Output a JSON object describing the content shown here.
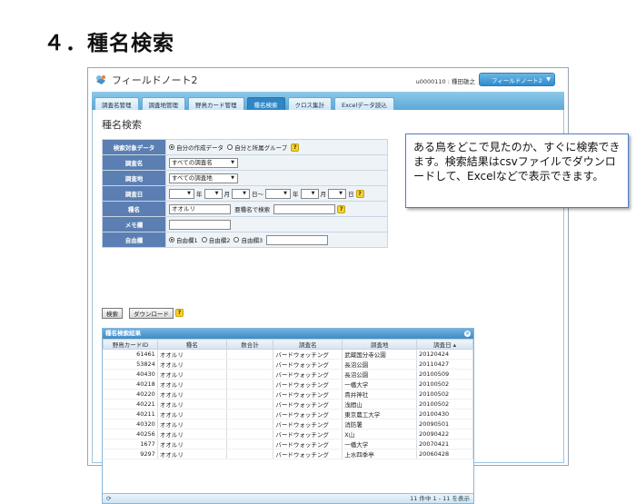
{
  "slide_title": "４．種名検索",
  "app": {
    "title": "フィールドノート2",
    "user": "u0000110 : 種田雄之",
    "selector": "フィールドノート2"
  },
  "tabs": [
    "調査名管理",
    "調査地管理",
    "野鳥カード管理",
    "種名検索",
    "クロス集計",
    "Excelデータ読込"
  ],
  "active_tab": 3,
  "page_heading": "種名検索",
  "form": {
    "target_label": "検索対象データ",
    "target_opt1": "自分の作成データ",
    "target_opt2": "自分と所属グループ",
    "survey_label": "調査名",
    "survey_value": "すべての調査名",
    "site_label": "調査地",
    "site_value": "すべての調査地",
    "date_label": "調査日",
    "date_year": "年",
    "date_month": "月",
    "date_day_from": "日～",
    "date_day_to": "日",
    "species_label": "種名",
    "species_value": "オオルリ",
    "species_sub": "亜種名で検索",
    "memo_label": "メモ欄",
    "free_label": "自由欄",
    "free_opt1": "自由欄1",
    "free_opt2": "自由欄2",
    "free_opt3": "自由欄3"
  },
  "buttons": {
    "search": "検索",
    "download": "ダウンロード"
  },
  "help_glyph": "?",
  "callout": "ある鳥をどこで見たのか、すぐに検索できます。検索結果はcsvファイルでダウンロードして、Excelなどで表示できます。",
  "results": {
    "title": "種名検索結果",
    "columns": [
      "野鳥カードID",
      "種名",
      "数合計",
      "調査名",
      "調査地",
      "調査日 ▴"
    ],
    "rows": [
      [
        "61461",
        "オオルリ",
        "",
        "バードウォッチング",
        "武蔵国分寺公園",
        "20120424"
      ],
      [
        "53824",
        "オオルリ",
        "",
        "バードウォッチング",
        "長沼公園",
        "20110427"
      ],
      [
        "40430",
        "オオルリ",
        "",
        "バードウォッチング",
        "長沼公園",
        "20100509"
      ],
      [
        "40218",
        "オオルリ",
        "",
        "バードウォッチング",
        "一橋大学",
        "20100502"
      ],
      [
        "40220",
        "オオルリ",
        "",
        "バードウォッチング",
        "貴井神社",
        "20100502"
      ],
      [
        "40221",
        "オオルリ",
        "",
        "バードウォッチング",
        "浅間山",
        "20100502"
      ],
      [
        "40211",
        "オオルリ",
        "",
        "バードウォッチング",
        "東京農工大学",
        "20100430"
      ],
      [
        "40320",
        "オオルリ",
        "",
        "バードウォッチング",
        "消防署",
        "20090501"
      ],
      [
        "40256",
        "オオルリ",
        "",
        "バードウォッチング",
        "X山",
        "20090422"
      ],
      [
        "1677",
        "オオルリ",
        "",
        "バードウォッチング",
        "一橋大学",
        "20070421"
      ],
      [
        "9297",
        "オオルリ",
        "",
        "バードウォッチング",
        "上水四季亭",
        "20060428"
      ]
    ],
    "pager": "11 件中 1 - 11 を表示",
    "refresh_glyph": "⟳"
  }
}
